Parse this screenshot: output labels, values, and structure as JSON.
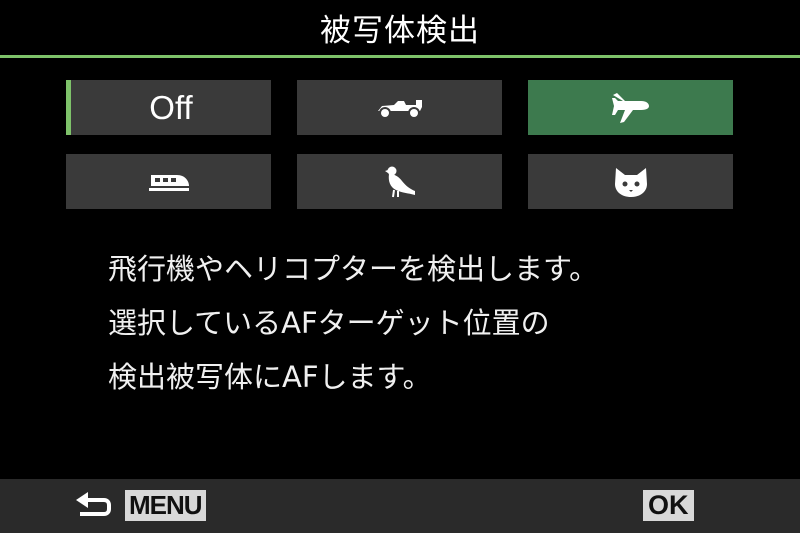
{
  "header": {
    "title": "被写体検出"
  },
  "options": [
    {
      "label": "Off",
      "icon": null,
      "state": "focused"
    },
    {
      "label": null,
      "icon": "race-car-icon",
      "state": "normal"
    },
    {
      "label": null,
      "icon": "airplane-icon",
      "state": "selected"
    },
    {
      "label": null,
      "icon": "train-icon",
      "state": "normal"
    },
    {
      "label": null,
      "icon": "bird-icon",
      "state": "normal"
    },
    {
      "label": null,
      "icon": "cat-icon",
      "state": "normal"
    }
  ],
  "description": {
    "line1": "飛行機やヘリコプターを検出します。",
    "line2": "選択しているAFターゲット位置の",
    "line3": "検出被写体にAFします。"
  },
  "footer": {
    "menu_label": "MENU",
    "ok_label": "OK"
  },
  "colors": {
    "accent": "#7ec26a",
    "selected_bg": "#3d7a4e",
    "option_bg": "#3a3a3a",
    "footer_bg": "#2a2a2a"
  }
}
